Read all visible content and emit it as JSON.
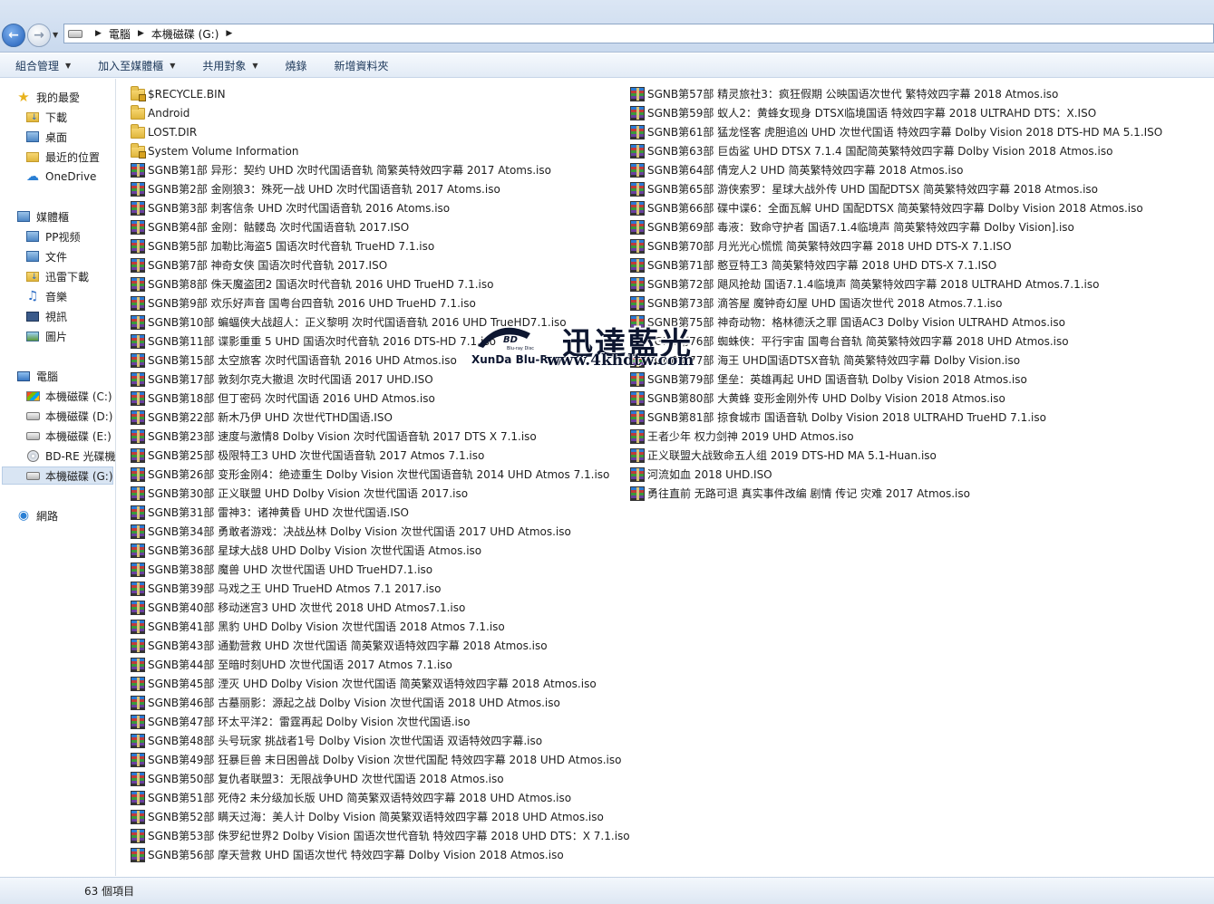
{
  "address": {
    "segments": [
      "電腦",
      "本機磁碟 (G:)"
    ]
  },
  "toolbar": {
    "items": [
      {
        "label": "組合管理",
        "dropdown": true
      },
      {
        "label": "加入至媒體櫃",
        "dropdown": true
      },
      {
        "label": "共用對象",
        "dropdown": true
      },
      {
        "label": "燒錄",
        "dropdown": false
      },
      {
        "label": "新增資料夾",
        "dropdown": false
      }
    ]
  },
  "nav": {
    "favorites": {
      "label": "我的最愛",
      "items": [
        "下載",
        "桌面",
        "最近的位置",
        "OneDrive"
      ]
    },
    "libraries": {
      "label": "媒體櫃",
      "items": [
        "PP视频",
        "文件",
        "迅雷下載",
        "音樂",
        "視訊",
        "圖片"
      ]
    },
    "computer": {
      "label": "電腦",
      "items": [
        "本機磁碟 (C:)",
        "本機磁碟 (D:)",
        "本機磁碟 (E:)",
        "BD-RE 光碟機",
        "本機磁碟 (G:)"
      ]
    },
    "network": {
      "label": "網路"
    }
  },
  "files": {
    "col1": [
      {
        "name": "$RECYCLE.BIN",
        "type": "lockfolder"
      },
      {
        "name": "Android",
        "type": "folder"
      },
      {
        "name": "LOST.DIR",
        "type": "folder"
      },
      {
        "name": "System Volume Information",
        "type": "lockfolder"
      },
      {
        "name": "SGNB第1部  异形：契约 UHD 次时代国语音轨 简繁英特效四字幕 2017 Atoms.iso",
        "type": "iso"
      },
      {
        "name": "SGNB第2部  金刚狼3：殊死一战 UHD 次时代国语音轨 2017 Atoms.iso",
        "type": "iso"
      },
      {
        "name": "SGNB第3部  刺客信条 UHD 次时代国语音轨 2016 Atoms.iso",
        "type": "iso"
      },
      {
        "name": "SGNB第4部  金刚：骷髅岛 次时代国语音轨 2017.ISO",
        "type": "iso"
      },
      {
        "name": "SGNB第5部  加勒比海盗5 国语次时代音轨 TrueHD 7.1.iso",
        "type": "iso"
      },
      {
        "name": "SGNB第7部  神奇女侠 国语次时代音轨 2017.ISO",
        "type": "iso"
      },
      {
        "name": "SGNB第8部  侏天魔盗团2 国语次时代音轨 2016 UHD TrueHD 7.1.iso",
        "type": "iso"
      },
      {
        "name": "SGNB第9部  欢乐好声音 国粤台四音轨 2016 UHD TrueHD 7.1.iso",
        "type": "iso"
      },
      {
        "name": "SGNB第10部 蝙蝠侠大战超人：正义黎明 次时代国语音轨 2016 UHD TrueHD7.1.iso",
        "type": "iso"
      },
      {
        "name": "SGNB第11部 谍影重重 5 UHD 国语次时代音轨 2016 DTS-HD 7.1.iso",
        "type": "iso"
      },
      {
        "name": "SGNB第15部 太空旅客 次时代国语音轨 2016 UHD Atmos.iso",
        "type": "iso"
      },
      {
        "name": "SGNB第17部 敦刻尔克大撤退 次时代国语  2017 UHD.ISO",
        "type": "iso"
      },
      {
        "name": "SGNB第18部 但丁密码  次时代国语 2016 UHD Atmos.iso",
        "type": "iso"
      },
      {
        "name": "SGNB第22部 新木乃伊 UHD 次世代THD国语.ISO",
        "type": "iso"
      },
      {
        "name": "SGNB第23部 速度与激情8  Dolby Vision 次时代国语音轨 2017 DTS X 7.1.iso",
        "type": "iso"
      },
      {
        "name": "SGNB第25部 极限特工3 UHD 次世代国语音轨 2017  Atmos 7.1.iso",
        "type": "iso"
      },
      {
        "name": "SGNB第26部 变形金刚4：绝迹重生 Dolby Vision 次世代国语音轨 2014 UHD Atmos 7.1.iso",
        "type": "iso"
      },
      {
        "name": "SGNB第30部 正义联盟 UHD Dolby Vision 次世代国语 2017.iso",
        "type": "iso"
      },
      {
        "name": "SGNB第31部 雷神3：诸神黄昏 UHD 次世代国语.ISO",
        "type": "iso"
      },
      {
        "name": "SGNB第34部 勇敢者游戏：决战丛林 Dolby Vision 次世代国语 2017 UHD Atmos.iso",
        "type": "iso"
      },
      {
        "name": "SGNB第36部 星球大战8 UHD Dolby Vision 次世代国语 Atmos.iso",
        "type": "iso"
      },
      {
        "name": "SGNB第38部 魔兽 UHD 次世代国语 UHD TrueHD7.1.iso",
        "type": "iso"
      },
      {
        "name": "SGNB第39部 马戏之王 UHD TrueHD Atmos 7.1 2017.iso",
        "type": "iso"
      },
      {
        "name": "SGNB第40部 移动迷宫3 UHD 次世代  2018 UHD Atmos7.1.iso",
        "type": "iso"
      },
      {
        "name": "SGNB第41部 黑豹 UHD Dolby Vision 次世代国语 2018 Atmos 7.1.iso",
        "type": "iso"
      },
      {
        "name": "SGNB第43部 通勤营救 UHD 次世代国语 简英繁双语特效四字幕 2018 Atmos.iso",
        "type": "iso"
      },
      {
        "name": "SGNB第44部 至暗时刻UHD 次世代国语  2017 Atmos 7.1.iso",
        "type": "iso"
      },
      {
        "name": "SGNB第45部 湮灭 UHD Dolby Vision 次世代国语  简英繁双语特效四字幕 2018 Atmos.iso",
        "type": "iso"
      },
      {
        "name": "SGNB第46部 古墓丽影：源起之战 Dolby Vision 次世代国语 2018 UHD Atmos.iso",
        "type": "iso"
      },
      {
        "name": "SGNB第47部 环太平洋2：雷霆再起  Dolby Vision 次世代国语.iso",
        "type": "iso"
      },
      {
        "name": "SGNB第48部 头号玩家 挑战者1号 Dolby Vision 次世代国语 双语特效四字幕.iso",
        "type": "iso"
      },
      {
        "name": "SGNB第49部 狂暴巨兽 末日困兽战 Dolby Vision 次世代国配 特效四字幕 2018 UHD Atmos.iso",
        "type": "iso"
      },
      {
        "name": "SGNB第50部 复仇者联盟3：无限战争UHD 次世代国语 2018 Atmos.iso",
        "type": "iso"
      },
      {
        "name": "SGNB第51部 死侍2 未分级加长版 UHD 简英繁双语特效四字幕 2018 UHD Atmos.iso",
        "type": "iso"
      },
      {
        "name": "SGNB第52部 瞒天过海：美人计 Dolby Vision 简英繁双语特效四字幕 2018 UHD Atmos.iso",
        "type": "iso"
      },
      {
        "name": "SGNB第53部 侏罗纪世界2 Dolby Vision 国语次世代音轨 特效四字幕 2018 UHD DTS：X 7.1.iso",
        "type": "iso"
      },
      {
        "name": "SGNB第56部 摩天营救 UHD 国语次世代 特效四字幕 Dolby Vision 2018 Atmos.iso",
        "type": "iso"
      }
    ],
    "col2": [
      {
        "name": "SGNB第57部 精灵旅社3：疯狂假期 公映国语次世代 繁特效四字幕 2018 Atmos.iso",
        "type": "iso"
      },
      {
        "name": "SGNB第59部 蚁人2：黄蜂女现身 DTSX临境国语 特效四字幕 2018 ULTRAHD DTS：X.ISO",
        "type": "iso"
      },
      {
        "name": "SGNB第61部 猛龙怪客  虎胆追凶 UHD 次世代国语 特效四字幕 Dolby Vision 2018 DTS-HD MA 5.1.ISO",
        "type": "iso"
      },
      {
        "name": "SGNB第63部 巨齿鲨 UHD DTSX 7.1.4 国配简英繁特效四字幕 Dolby Vision 2018 Atmos.iso",
        "type": "iso"
      },
      {
        "name": "SGNB第64部 倩宠人2 UHD 简英繁特效四字幕 2018 Atmos.iso",
        "type": "iso"
      },
      {
        "name": "SGNB第65部 游侠索罗：星球大战外传 UHD 国配DTSX 简英繁特效四字幕 2018 Atmos.iso",
        "type": "iso"
      },
      {
        "name": "SGNB第66部 碟中谍6：全面瓦解 UHD 国配DTSX 简英繁特效四字幕 Dolby Vision 2018  Atmos.iso",
        "type": "iso"
      },
      {
        "name": "SGNB第69部 毒液：致命守护者 国语7.1.4临境声 简英繁特效四字幕 Dolby Vision].iso",
        "type": "iso"
      },
      {
        "name": "SGNB第70部 月光光心慌慌 简英繁特效四字幕 2018 UHD DTS-X 7.1.ISO",
        "type": "iso"
      },
      {
        "name": "SGNB第71部 憨豆特工3 简英繁特效四字幕 2018 UHD DTS-X 7.1.ISO",
        "type": "iso"
      },
      {
        "name": "SGNB第72部 飓风抢劫 国语7.1.4临境声 简英繁特效四字幕 2018 ULTRAHD  Atmos.7.1.iso",
        "type": "iso"
      },
      {
        "name": "SGNB第73部 滴答屋 魔钟奇幻屋 UHD 国语次世代 2018 Atmos.7.1.iso",
        "type": "iso"
      },
      {
        "name": "SGNB第75部 神奇动物：格林德沃之罪 国语AC3 Dolby Vision ULTRAHD Atmos.iso",
        "type": "iso"
      },
      {
        "name": "SGNB第76部 蜘蛛侠：平行宇宙 国粤台音轨 简英繁特效四字幕 2018 UHD Atmos.iso",
        "type": "iso"
      },
      {
        "name": "SGNB第77部 海王 UHD国语DTSX音轨 简英繁特效四字幕 Dolby Vision.iso",
        "type": "iso"
      },
      {
        "name": "SGNB第79部 堡垒：英雄再起 UHD 国语音轨 Dolby Vision 2018 Atmos.iso",
        "type": "iso"
      },
      {
        "name": "SGNB第80部 大黄蜂  变形金刚外传 UHD Dolby Vision 2018 Atmos.iso",
        "type": "iso"
      },
      {
        "name": "SGNB第81部 掠食城市 国语音轨 Dolby Vision 2018 ULTRAHD TrueHD 7.1.iso",
        "type": "iso"
      },
      {
        "name": "王者少年 权力剑神 2019 UHD Atmos.iso",
        "type": "iso"
      },
      {
        "name": "正义联盟大战致命五人组 2019 DTS-HD MA 5.1-Huan.iso",
        "type": "iso"
      },
      {
        "name": "河流如血 2018 UHD.ISO",
        "type": "iso"
      },
      {
        "name": "勇往直前 无路可退 真实事件改编 剧情  传记  灾难 2017 Atmos.iso",
        "type": "iso"
      }
    ]
  },
  "watermark": {
    "brand_cn": "迅達藍光",
    "brand_en": "XunDa Blu-Ray",
    "url": "www.4khdtw.com",
    "logo_text": "Blu-ray Disc"
  },
  "status": {
    "item_count": "63 個項目"
  }
}
